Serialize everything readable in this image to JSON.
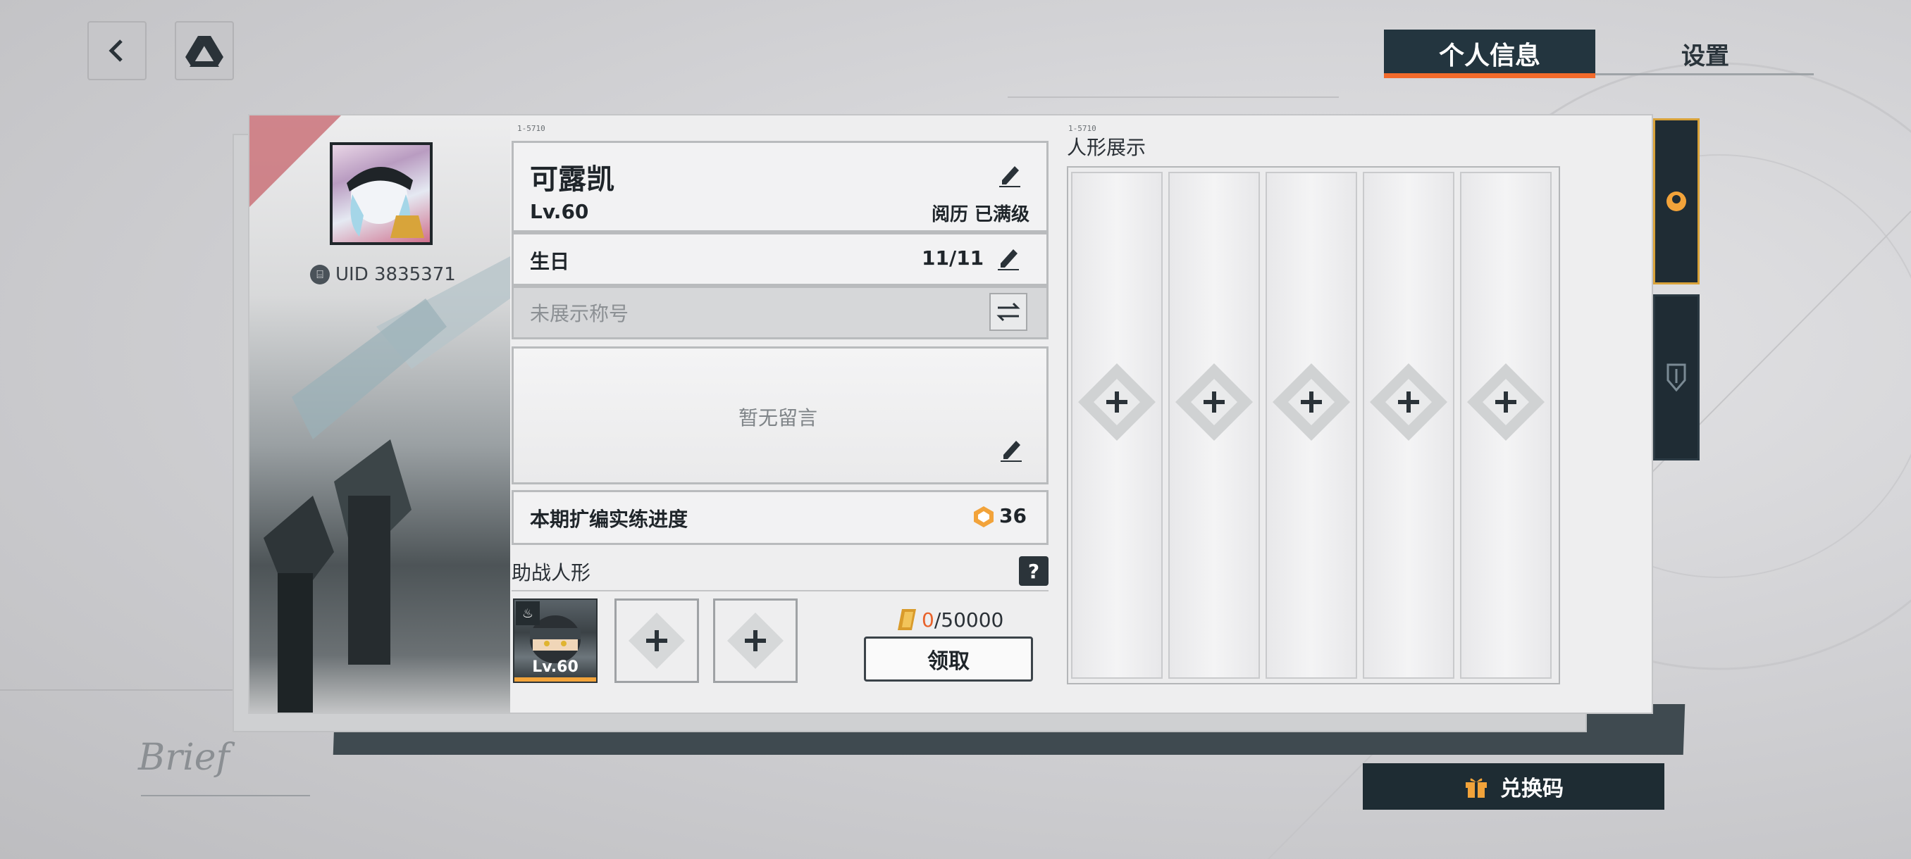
{
  "header": {
    "back_icon": "chevron-left-icon",
    "drive_icon": "triangle-logo-icon",
    "tabs": [
      {
        "label": "个人信息",
        "active": true
      },
      {
        "label": "设置",
        "active": false
      }
    ],
    "accent_color": "#f26a2b"
  },
  "profile": {
    "uid_label": "UID 3835371",
    "code_left": "1-5710",
    "code_right": "1-5710",
    "name": "可露凯",
    "level": "Lv.60",
    "rank": "阅历 已满级",
    "birthday_label": "生日",
    "birthday_value": "11/11",
    "title_placeholder": "未展示称号",
    "message": "暂无留言",
    "progress_label": "本期扩编实练进度",
    "progress_value": "36",
    "support_label": "助战人形",
    "help_label": "?",
    "support_dolls": [
      {
        "level": "Lv.60",
        "filled": true
      },
      {
        "filled": false
      },
      {
        "filled": false
      }
    ],
    "reward_current": "0",
    "reward_max": "/50000",
    "claim_label": "领取"
  },
  "display": {
    "title": "人形展示",
    "slots": 5
  },
  "footer": {
    "redeem_label": "兑换码",
    "brief": "Brief"
  }
}
